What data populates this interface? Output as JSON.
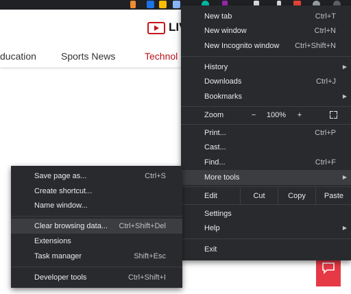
{
  "page": {
    "logo_text": "LIV",
    "nav_links": [
      "ducation",
      "Sports News",
      "Technol"
    ]
  },
  "main_menu": {
    "items": [
      {
        "label": "New tab",
        "shortcut": "Ctrl+T"
      },
      {
        "label": "New window",
        "shortcut": "Ctrl+N"
      },
      {
        "label": "New Incognito window",
        "shortcut": "Ctrl+Shift+N"
      },
      {
        "label": "History",
        "shortcut": ""
      },
      {
        "label": "Downloads",
        "shortcut": "Ctrl+J"
      },
      {
        "label": "Bookmarks",
        "shortcut": ""
      },
      {
        "label": "Print...",
        "shortcut": "Ctrl+P"
      },
      {
        "label": "Cast...",
        "shortcut": ""
      },
      {
        "label": "Find...",
        "shortcut": "Ctrl+F"
      },
      {
        "label": "More tools",
        "shortcut": ""
      },
      {
        "label": "Settings",
        "shortcut": ""
      },
      {
        "label": "Help",
        "shortcut": ""
      },
      {
        "label": "Exit",
        "shortcut": ""
      }
    ],
    "zoom": {
      "label": "Zoom",
      "minus": "−",
      "value": "100%",
      "plus": "+"
    },
    "edit": {
      "label": "Edit",
      "cut": "Cut",
      "copy": "Copy",
      "paste": "Paste"
    }
  },
  "sub_menu": {
    "items": [
      {
        "label": "Save page as...",
        "shortcut": "Ctrl+S"
      },
      {
        "label": "Create shortcut...",
        "shortcut": ""
      },
      {
        "label": "Name window...",
        "shortcut": ""
      },
      {
        "label": "Clear browsing data...",
        "shortcut": "Ctrl+Shift+Del"
      },
      {
        "label": "Extensions",
        "shortcut": ""
      },
      {
        "label": "Task manager",
        "shortcut": "Shift+Esc"
      },
      {
        "label": "Developer tools",
        "shortcut": "Ctrl+Shift+I"
      }
    ]
  },
  "colors": {
    "menu_bg": "#292a2d",
    "highlight": "#3c3d40",
    "accent_red": "#e63946",
    "active_link": "#b5121b"
  }
}
